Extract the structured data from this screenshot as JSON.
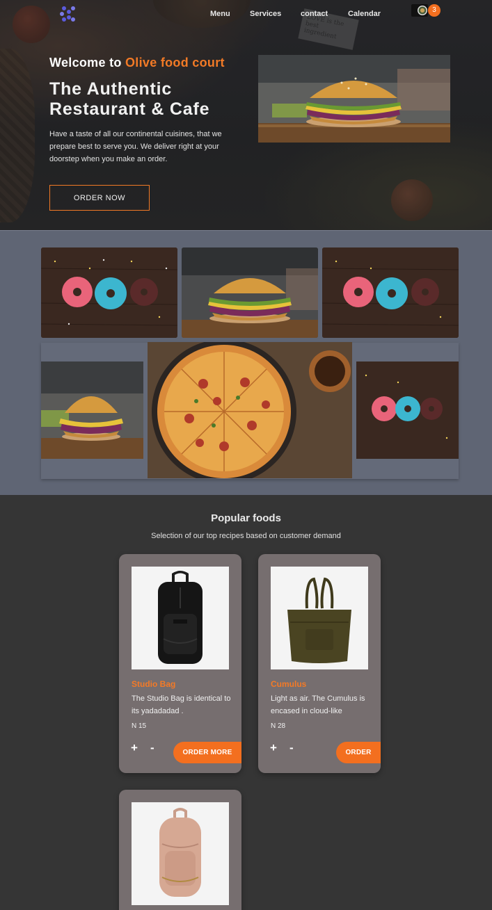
{
  "nav": {
    "items": [
      "Menu",
      "Services",
      "contact",
      "Calendar"
    ]
  },
  "cart": {
    "count": "3"
  },
  "hero": {
    "welcome_prefix": "Welcome to",
    "brand": "Olive food court",
    "headline": "The Authentic Restaurant & Cafe",
    "description": "Have a taste of all our continental cuisines, that we prepare best to serve you. We deliver right at your doorstep when you make an order.",
    "cta_label": "ORDER NOW",
    "paper_text": "LOVE is the best ingredient"
  },
  "gallery": {
    "items": [
      "donuts",
      "burger",
      "donuts",
      "burger",
      "pizza",
      "donuts"
    ]
  },
  "popular": {
    "title": "Popular foods",
    "subtitle": "Selection of our top recipes based on customer demand",
    "products": [
      {
        "name": "Studio Bag",
        "description": "The Studio Bag is identical to its yadadadad .",
        "price": "N 15",
        "plus": "+",
        "minus": "-",
        "cta": "ORDER MORE",
        "image": "black-backpack"
      },
      {
        "name": "Cumulus",
        "description": "Light as air. The Cumulus is encased in cloud-like",
        "price": "N 28",
        "plus": "+",
        "minus": "-",
        "cta": "ORDER",
        "image": "olive-tote-bag"
      },
      {
        "name": "",
        "description": "",
        "price": "",
        "image": "pink-backpack"
      }
    ]
  },
  "colors": {
    "accent": "#f27a26",
    "button": "#f36f1f",
    "gallery_bg": "#5f6574",
    "card_bg": "#766e6f",
    "page_bg": "#353535"
  }
}
